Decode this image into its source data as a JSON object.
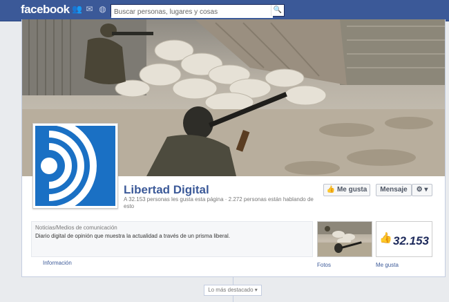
{
  "header": {
    "logo": "facebook",
    "search_placeholder": "Buscar personas, lugares y cosas"
  },
  "page": {
    "name": "Libertad Digital",
    "stats": "A 32.153 personas les gusta esta página · 2.272 personas están hablando de esto",
    "like_button": "Me gusta",
    "message_button": "Mensaje",
    "gear_button": "⚙ ▾",
    "category": "Noticias/Medios de comunicación",
    "description": "Diario digital de opinión que muestra la actualidad a través de un prisma liberal.",
    "info_link": "Información",
    "photos_label": "Fotos",
    "likes_count": "32.153",
    "likes_label": "Me gusta",
    "highlights_dropdown": "Lo más destacado"
  },
  "colors": {
    "brand": "#3b5998",
    "logo_blue": "#1a70c4"
  }
}
